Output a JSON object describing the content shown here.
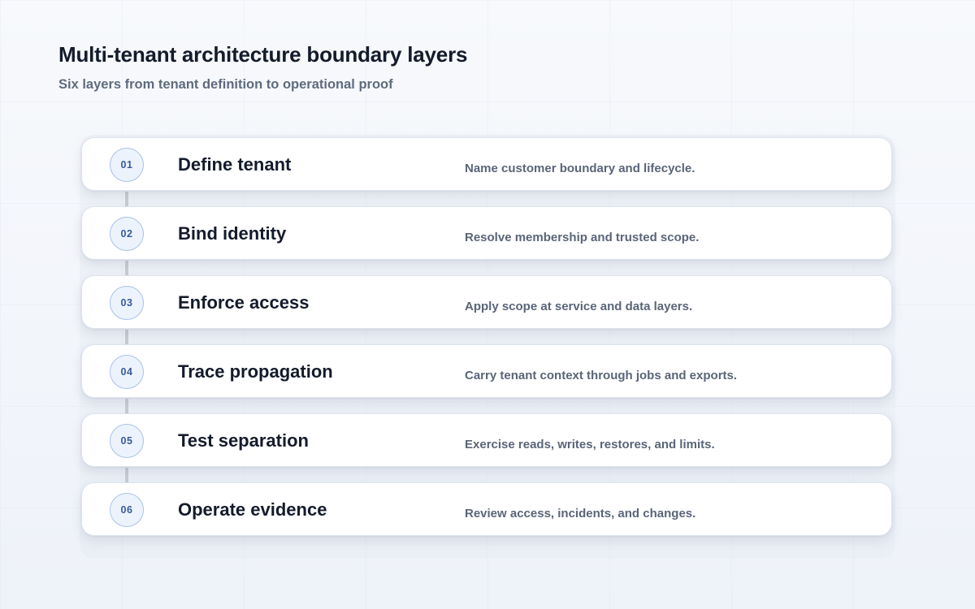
{
  "header": {
    "title": "Multi-tenant architecture boundary layers",
    "subtitle": "Six layers from tenant definition to operational proof"
  },
  "layers": [
    {
      "number": "01",
      "title": "Define tenant",
      "description": "Name customer boundary and lifecycle."
    },
    {
      "number": "02",
      "title": "Bind identity",
      "description": "Resolve membership and trusted scope."
    },
    {
      "number": "03",
      "title": "Enforce access",
      "description": "Apply scope at service and data layers."
    },
    {
      "number": "04",
      "title": "Trace propagation",
      "description": "Carry tenant context through jobs and exports."
    },
    {
      "number": "05",
      "title": "Test separation",
      "description": "Exercise reads, writes, restores, and limits."
    },
    {
      "number": "06",
      "title": "Operate evidence",
      "description": "Review access, incidents, and changes."
    }
  ],
  "colors": {
    "title_text": "#141b2b",
    "muted_text": "#5a6577",
    "badge_border": "#a9c2ea",
    "badge_fill": "#edf3fc",
    "badge_text": "#3a5a99",
    "connector": "#c8ccd4",
    "card_background": "#ffffff"
  }
}
